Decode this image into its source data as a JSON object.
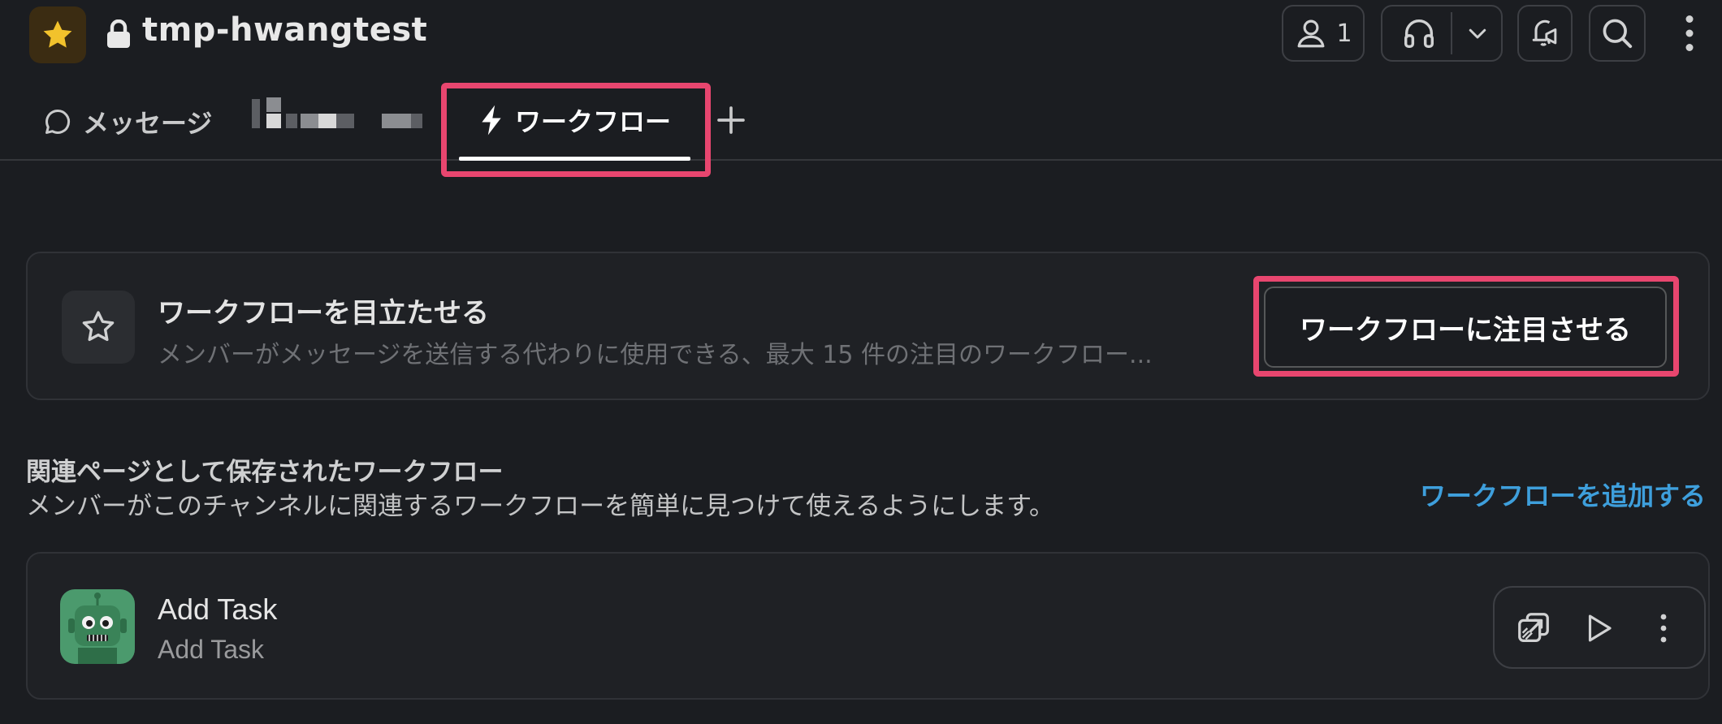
{
  "header": {
    "workspace_icon": "star-icon",
    "lock_icon": "lock-icon",
    "channel_name": "tmp-hwangtest",
    "members_count": "1",
    "icons": [
      "user-icon",
      "headphones-icon",
      "chevron-down-icon",
      "bell-megaphone-icon",
      "search-icon",
      "kebab-menu-icon"
    ]
  },
  "tabs": {
    "messages_label": "メッセージ",
    "workflow_label": "ワークフロー",
    "add_icon": "plus-icon"
  },
  "featured": {
    "title": "ワークフローを目立たせる",
    "description": "メンバーがメッセージを送信する代わりに使用できる、最大 15 件の注目のワークフロー...",
    "button_label": "ワークフローに注目させる"
  },
  "related": {
    "title": "関連ページとして保存されたワークフロー",
    "description": "メンバーがこのチャンネルに関連するワークフローを簡単に見つけて使えるようにします。",
    "add_link": "ワークフローを追加する"
  },
  "workflows": [
    {
      "name": "Add Task",
      "subtitle": "Add Task",
      "avatar": "robot-icon"
    }
  ],
  "colors": {
    "background": "#1b1d21",
    "highlight": "#e8466f",
    "link": "#3e9fdc",
    "workspace_icon_bg": "#3b2c12",
    "star": "#f2c22c",
    "robot_bg": "#4b9a6d"
  }
}
